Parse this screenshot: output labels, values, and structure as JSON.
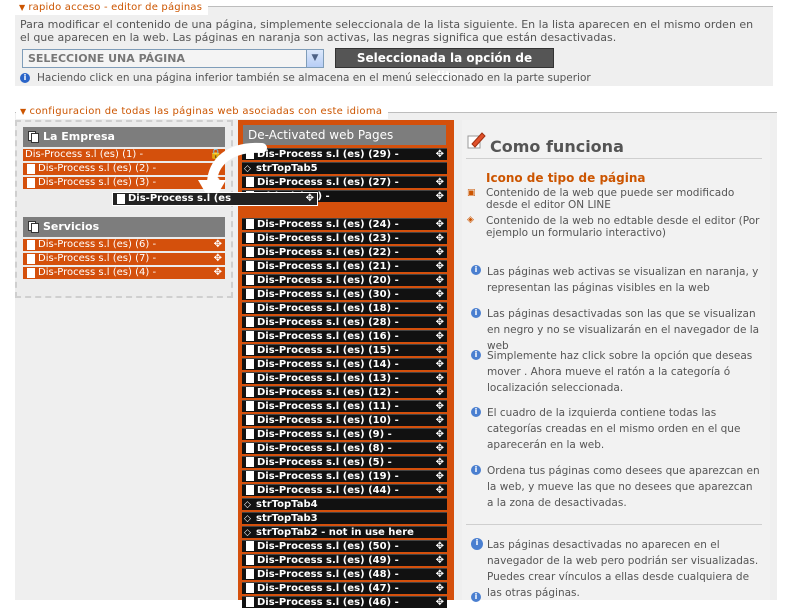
{
  "quick_access": {
    "tab": "rapido acceso - editor de páginas",
    "description": "Para modificar el contenido de una página, simplemente seleccionala de la lista siguiente. En la lista aparecen en el mismo orden en el que aparecen en la web. Las páginas en naranja son activas, las negras significa que están desactivadas.",
    "select_value": "SELECCIONE UNA PÁGINA",
    "edit_button": "Seleccionada la opción de editar",
    "hint": "Haciendo click en una página inferior también se almacena en el menú seleccionado en la parte superior"
  },
  "config": {
    "tab": "configuracion de todas las páginas web asociadas con este idioma"
  },
  "categories": [
    {
      "title": "La Empresa",
      "pages": [
        {
          "label": "Dis-Process s.l (es) (1) -",
          "locked": true
        },
        {
          "label": "Dis-Process s.l (es) (2) -",
          "locked": false
        },
        {
          "label": "Dis-Process s.l (es) (3) -",
          "locked": false
        }
      ]
    },
    {
      "title": "Servicios",
      "pages": [
        {
          "label": "Dis-Process s.l (es) (6) -",
          "locked": false
        },
        {
          "label": "Dis-Process s.l (es) (7) -",
          "locked": false
        },
        {
          "label": "Dis-Process s.l (es) (4) -",
          "locked": false
        }
      ]
    }
  ],
  "dragging_item": "Dis-Process s.l (es",
  "deactivated": {
    "title": "De-Activated web Pages",
    "rows": [
      {
        "label": "Dis-Process s.l (es) (29) -",
        "kind": "page"
      },
      {
        "label": "strTopTab5",
        "kind": "link"
      },
      {
        "label": "Dis-Process s.l (es) (27) -",
        "kind": "page"
      },
      {
        "label": "s.l (es) (25) -",
        "kind": "page"
      },
      {
        "label": "",
        "kind": "gap"
      },
      {
        "label": "Dis-Process s.l (es) (24) -",
        "kind": "page"
      },
      {
        "label": "Dis-Process s.l (es) (23) -",
        "kind": "page"
      },
      {
        "label": "Dis-Process s.l (es) (22) -",
        "kind": "page"
      },
      {
        "label": "Dis-Process s.l (es) (21) -",
        "kind": "page"
      },
      {
        "label": "Dis-Process s.l (es) (20) -",
        "kind": "page"
      },
      {
        "label": "Dis-Process s.l (es) (30) -",
        "kind": "page"
      },
      {
        "label": "Dis-Process s.l (es) (18) -",
        "kind": "page"
      },
      {
        "label": "Dis-Process s.l (es) (28) -",
        "kind": "page"
      },
      {
        "label": "Dis-Process s.l (es) (16) -",
        "kind": "page"
      },
      {
        "label": "Dis-Process s.l (es) (15) -",
        "kind": "page"
      },
      {
        "label": "Dis-Process s.l (es) (14) -",
        "kind": "page"
      },
      {
        "label": "Dis-Process s.l (es) (13) -",
        "kind": "page"
      },
      {
        "label": "Dis-Process s.l (es) (12) -",
        "kind": "page"
      },
      {
        "label": "Dis-Process s.l (es) (11) -",
        "kind": "page"
      },
      {
        "label": "Dis-Process s.l (es) (10) -",
        "kind": "page"
      },
      {
        "label": "Dis-Process s.l (es) (9) -",
        "kind": "page"
      },
      {
        "label": "Dis-Process s.l (es) (8) -",
        "kind": "page"
      },
      {
        "label": "Dis-Process s.l (es) (5) -",
        "kind": "page"
      },
      {
        "label": "Dis-Process s.l (es) (19) -",
        "kind": "page"
      },
      {
        "label": "Dis-Process s.l (es) (44) -",
        "kind": "page"
      },
      {
        "label": "strTopTab4",
        "kind": "link"
      },
      {
        "label": "strTopTab3",
        "kind": "link"
      },
      {
        "label": "strTopTab2 - not in use here",
        "kind": "link"
      },
      {
        "label": "Dis-Process s.l (es) (50) -",
        "kind": "page"
      },
      {
        "label": "Dis-Process s.l (es) (49) -",
        "kind": "page"
      },
      {
        "label": "Dis-Process s.l (es) (48) -",
        "kind": "page"
      },
      {
        "label": "Dis-Process s.l (es) (47) -",
        "kind": "page"
      },
      {
        "label": "Dis-Process s.l (es) (46) -",
        "kind": "page"
      }
    ]
  },
  "info": {
    "title": "Como funciona",
    "icon_heading": "Icono de tipo de página",
    "legend": [
      "Contenido de la web que puede ser modificado desde el editor ON LINE",
      "Contenido de la web no edtable desde el editor (Por ejemplo un formulario interactivo)"
    ],
    "paragraphs": [
      "Las páginas web activas se visualizan en naranja, y representan las páginas visibles en la web",
      "Las páginas desactivadas son las que se visualizan en negro y no se visualizarán en el navegador de la web",
      "Simplemente haz click sobre la opción que deseas mover . Ahora mueve el ratón a la categoría ó localización seleccionada.",
      "El cuadro de la izquierda contiene todas las categorías creadas en el mismo orden en el que aparecerán en la web.",
      "Ordena tus páginas como desees que aparezcan en la web, y mueve las que no desees que aparezcan a la zona de desactivadas."
    ],
    "note": "Las páginas desactivadas no aparecen en el navegador de la web pero podrián ser visualizadas. Puedes crear vínculos a ellas desde cualquiera de las otras páginas."
  }
}
